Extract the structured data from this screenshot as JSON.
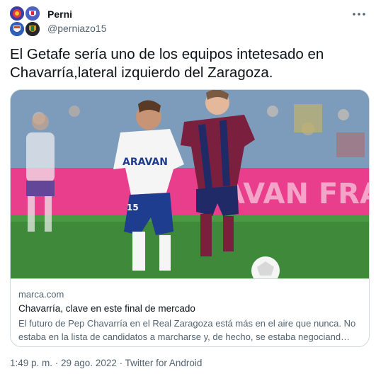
{
  "author": {
    "display_name": "Perni",
    "handle": "@perniazo15"
  },
  "tweet": {
    "text": "El Getafe sería uno de los equipos intetesado en Chavarría,lateral izquierdo del Zaragoza."
  },
  "card": {
    "domain": "marca.com",
    "title": "Chavarría, clave en este final de mercado",
    "description": "El futuro de Pep Chavarría en el Real Zaragoza está más en el aire que nunca. No estaba en la lista de candidatos a marcharse y, de hecho, se estaba negociand…",
    "image": {
      "jersey_text": "ARAVAN",
      "banner_text": "AVAN FRA",
      "player_number": "15"
    }
  },
  "meta": {
    "timestamp": "1:49 p. m. · 29 ago. 2022 · Twitter for Android"
  },
  "icons": {
    "more": "more-horizontal-icon"
  }
}
